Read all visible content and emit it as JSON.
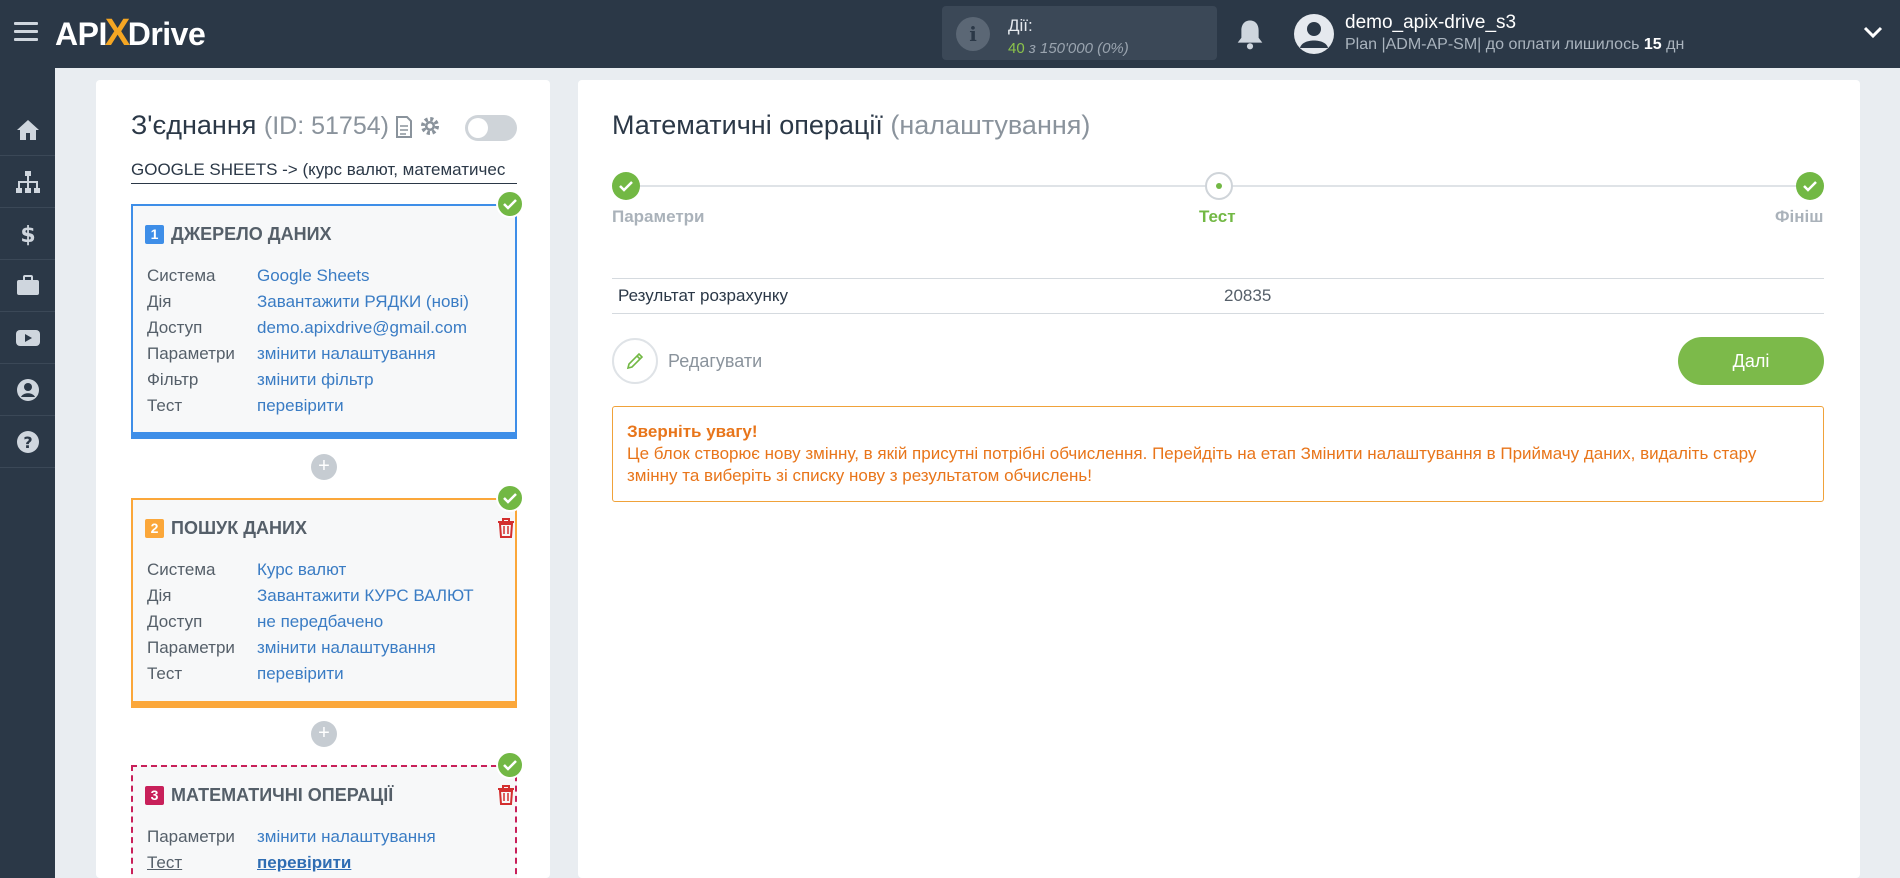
{
  "header": {
    "logo_api": "API",
    "logo_x": "X",
    "logo_drive": "Drive",
    "actions_label": "Дії:",
    "actions_used": "40",
    "actions_of": "з 150'000",
    "actions_pct": "(0%)",
    "user_name": "demo_apix-drive_s3",
    "plan_text": "Plan |ADM-AP-SM| до оплати лишилось",
    "plan_days": "15",
    "plan_days_unit": "дн"
  },
  "sidebar": {
    "items": [
      "home-icon",
      "sitemap-icon",
      "dollar-icon",
      "briefcase-icon",
      "youtube-icon",
      "user-icon",
      "help-icon"
    ]
  },
  "connection": {
    "title": "З'єднання",
    "id_text": "(ID: 51754)",
    "name": "GOOGLE SHEETS -> (курс валют, математичес",
    "enabled": false
  },
  "blocks": [
    {
      "num": "1",
      "title": "ДЖЕРЕЛО ДАНИХ",
      "rows": [
        {
          "k": "Система",
          "v": "Google Sheets"
        },
        {
          "k": "Дія",
          "v": "Завантажити РЯДКИ (нові)"
        },
        {
          "k": "Доступ",
          "v": "demo.apixdrive@gmail.com"
        },
        {
          "k": "Параметри",
          "v": "змінити налаштування"
        },
        {
          "k": "Фільтр",
          "v": "змінити фільтр"
        },
        {
          "k": "Тест",
          "v": "перевірити"
        }
      ]
    },
    {
      "num": "2",
      "title": "ПОШУК ДАНИХ",
      "rows": [
        {
          "k": "Система",
          "v": "Курс валют"
        },
        {
          "k": "Дія",
          "v": "Завантажити КУРС ВАЛЮТ"
        },
        {
          "k": "Доступ",
          "v": "не передбачено"
        },
        {
          "k": "Параметри",
          "v": "змінити налаштування"
        },
        {
          "k": "Тест",
          "v": "перевірити"
        }
      ]
    },
    {
      "num": "3",
      "title": "МАТЕМАТИЧНІ ОПЕРАЦІЇ",
      "rows": [
        {
          "k": "Параметри",
          "v": "змінити налаштування"
        },
        {
          "k": "Тест",
          "v": "перевірити"
        }
      ]
    }
  ],
  "main": {
    "title": "Математичні операції",
    "title_suffix": "(налаштування)",
    "steps": [
      {
        "label": "Параметри",
        "state": "done"
      },
      {
        "label": "Тест",
        "state": "current"
      },
      {
        "label": "Фініш",
        "state": "done"
      }
    ],
    "result_label": "Результат розрахунку",
    "result_value": "20835",
    "edit_label": "Редагувати",
    "next_label": "Далі",
    "warning_title": "Зверніть увагу!",
    "warning_text": "Це блок створює нову змінну, в якій присутні потрібні обчислення. Перейдіть на етап Змінити налаштування в Приймачу даних, видаліть стару змінну та виберіть зі списку нову з результатом обчислень!"
  },
  "colors": {
    "topbar": "#2b3847",
    "accent_green": "#72b844",
    "block1": "#3e8ee8",
    "block2": "#fba73a",
    "block3": "#c8205a",
    "warning": "#e8751a"
  }
}
